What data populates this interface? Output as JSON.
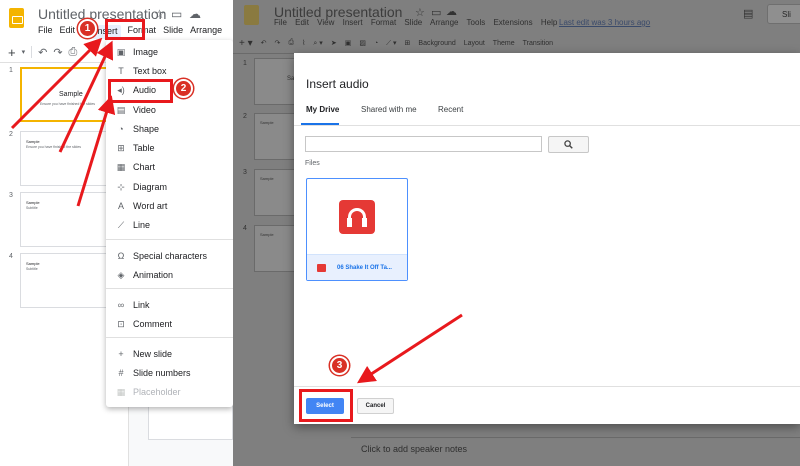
{
  "app": {
    "title": "Untitled presentation",
    "menus": [
      "File",
      "Edit",
      "View",
      "Insert",
      "Format",
      "Slide",
      "Arrange",
      "Tools",
      "Extensions",
      "Help"
    ],
    "left_menus": [
      "File",
      "Edit",
      "Insert",
      "Format",
      "Slide",
      "Arrange"
    ],
    "last_edit": "Last edit was 3 hours ago",
    "slides_button": "Sli",
    "toolbar_right": [
      "Background",
      "Layout",
      "Theme",
      "Transition"
    ],
    "speaker_notes": "Click to add speaker notes"
  },
  "slides": [
    {
      "num": "1",
      "title": "Sample",
      "subtitle": "Ensure you have finished the slides"
    },
    {
      "num": "2",
      "title": "Sample",
      "subtitle": "Ensure you have finished the slides"
    },
    {
      "num": "3",
      "title": "Sample",
      "subtitle": "Subtitle"
    },
    {
      "num": "4",
      "title": "Sample",
      "subtitle": "Subtitle"
    }
  ],
  "right_slides": [
    {
      "num": "1",
      "title": "Sa"
    },
    {
      "num": "2",
      "title": "Sample"
    },
    {
      "num": "3",
      "title": "Sample"
    },
    {
      "num": "4",
      "title": "Sample"
    }
  ],
  "insert_menu": {
    "items": [
      {
        "label": "Image",
        "icon": "image-icon"
      },
      {
        "label": "Text box",
        "icon": "text-box-icon"
      },
      {
        "label": "Audio",
        "icon": "audio-icon"
      },
      {
        "label": "Video",
        "icon": "video-icon"
      },
      {
        "label": "Shape",
        "icon": "shape-icon"
      },
      {
        "label": "Table",
        "icon": "table-icon"
      },
      {
        "label": "Chart",
        "icon": "chart-icon"
      },
      {
        "label": "Diagram",
        "icon": "diagram-icon"
      },
      {
        "label": "Word art",
        "icon": "word-art-icon"
      },
      {
        "label": "Line",
        "icon": "line-icon"
      },
      {
        "label": "Special characters",
        "icon": "omega-icon"
      },
      {
        "label": "Animation",
        "icon": "animation-icon"
      },
      {
        "label": "Link",
        "icon": "link-icon"
      },
      {
        "label": "Comment",
        "icon": "comment-icon"
      },
      {
        "label": "New slide",
        "icon": "plus-icon"
      },
      {
        "label": "Slide numbers",
        "icon": "hash-icon"
      },
      {
        "label": "Placeholder",
        "icon": "placeholder-icon"
      }
    ]
  },
  "dialog": {
    "title": "Insert audio",
    "tabs": [
      "My Drive",
      "Shared with me",
      "Recent"
    ],
    "active_tab": "My Drive",
    "search_value": "",
    "files_label": "Files",
    "file_name": "06 Shake It Off Ta...",
    "select_label": "Select",
    "cancel_label": "Cancel"
  },
  "annotations": {
    "badges": [
      "1",
      "2",
      "3"
    ],
    "color": "#e8191d"
  },
  "colors": {
    "accent": "#1a73e8",
    "select_button": "#4285f4",
    "slides_logo": "#f4b400",
    "audio_icon": "#e53935"
  }
}
